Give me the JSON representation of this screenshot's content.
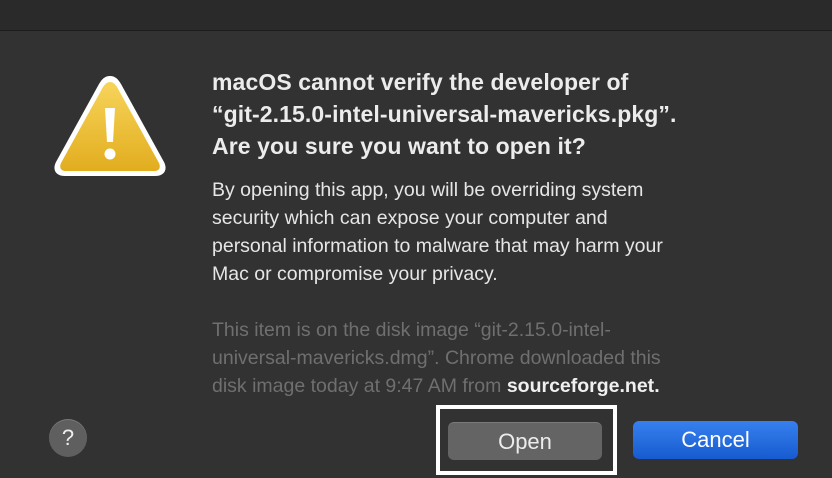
{
  "dialog": {
    "title_lines": [
      "macOS cannot verify the developer of",
      "“git-2.15.0-intel-universal-mavericks.pkg”.",
      "Are you sure you want to open it?"
    ],
    "body_lines": [
      "By opening this app, you will be overriding system",
      "security which can expose your computer and",
      "personal information to malware that may harm your",
      "Mac or compromise your privacy."
    ],
    "info_lines": [
      "This item is on the disk image “git-2.15.0-intel-",
      "universal-mavericks.dmg”. Chrome downloaded this",
      "disk image today at 9:47 AM from "
    ],
    "info_source": "sourceforge.net",
    "info_suffix": ".",
    "help_label": "?",
    "open_label": "Open",
    "cancel_label": "Cancel",
    "icon": "warning-triangle-icon",
    "colors": {
      "background": "#323232",
      "accent": "#1f67d8",
      "warning_yellow": "#f2c230"
    }
  }
}
